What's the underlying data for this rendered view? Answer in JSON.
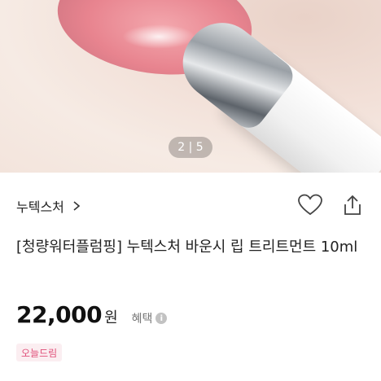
{
  "hero": {
    "page_indicator": "2 | 5",
    "image_alt": "lip treatment applied to lips"
  },
  "brand": {
    "name": "누텍스처",
    "chevron": ">"
  },
  "actions": {
    "wishlist_icon": "heart-icon",
    "share_icon": "share-icon"
  },
  "product": {
    "title": "[청량워터플럼핑] 누텍스처 바운시 립 트리트먼트 10ml",
    "price": "22,000",
    "currency": "원",
    "benefit_label": "혜택",
    "info_icon": "info-icon",
    "badge": "오늘드림"
  },
  "colors": {
    "badge_text": "#e0507a",
    "badge_bg": "#fbeef1"
  }
}
